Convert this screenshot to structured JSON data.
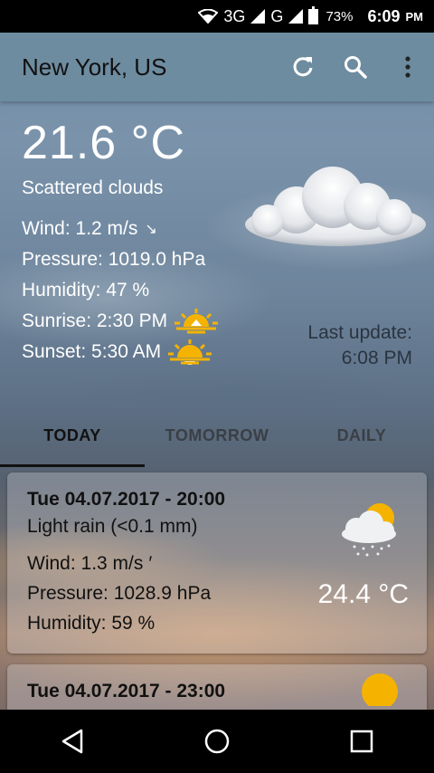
{
  "status_bar": {
    "network": "3G",
    "network2": "G",
    "battery": "73%",
    "time": "6:09",
    "ampm": "PM"
  },
  "app_bar": {
    "title": "New York, US",
    "refresh_icon": "refresh-icon",
    "search_icon": "search-icon",
    "menu_icon": "more-vert-icon"
  },
  "current": {
    "temperature": "21.6 °C",
    "description": "Scattered clouds",
    "wind": "Wind: 1.2 m/s",
    "wind_arrow": "↘",
    "pressure": "Pressure: 1019.0 hPa",
    "humidity": "Humidity: 47 %",
    "sunrise": "Sunrise: 2:30 PM",
    "sunset": "Sunset: 5:30 AM",
    "last_update_label": "Last update:",
    "last_update_time": "6:08 PM"
  },
  "tabs": [
    {
      "label": "TODAY",
      "active": true
    },
    {
      "label": "TOMORROW",
      "active": false
    },
    {
      "label": "DAILY",
      "active": false
    }
  ],
  "forecast": [
    {
      "date": "Tue 04.07.2017 - 20:00",
      "description": "Light rain (<0.1 mm)",
      "wind": "Wind: 1.3 m/s",
      "wind_arrow": "′",
      "pressure": "Pressure: 1028.9 hPa",
      "humidity": "Humidity: 59 %",
      "temperature": "24.4 °C",
      "icon": "sun-cloud-rain-icon"
    },
    {
      "date": "Tue 04.07.2017 - 23:00",
      "icon": "sun-icon"
    }
  ],
  "colors": {
    "app_bar": "#6e8ca0",
    "text_dark": "#111111",
    "text_light": "#ffffff",
    "sun": "#f5b300"
  }
}
